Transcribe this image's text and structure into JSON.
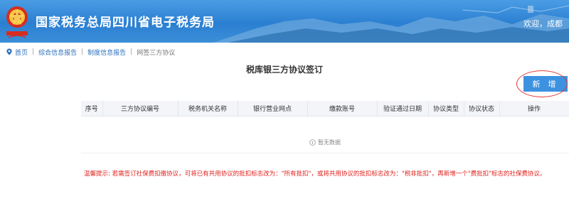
{
  "header": {
    "site_title": "国家税务总局四川省电子税务局",
    "welcome_text": "欢迎，成都"
  },
  "breadcrumb": {
    "items": [
      "首页",
      "综合信息报告",
      "制度信息报告"
    ],
    "current": "网签三方协议"
  },
  "page": {
    "title": "税库银三方协议签订",
    "add_button_label": "新 增"
  },
  "table": {
    "columns": [
      "序号",
      "三方协议编号",
      "税务机关名称",
      "银行营业网点",
      "缴款账号",
      "验证通过日期",
      "协议类型",
      "协议状态",
      "操作"
    ],
    "rows": [],
    "empty_text": "暂无数据"
  },
  "notice": {
    "text": "温馨提示: 若需签订社保费扣缴协议，可将已有共用协议的批扣标志改为：\"所有批扣\"，或将共用协议的批扣标志改为：\"税非批扣\"，再新增一个\"费批扣\"标志的社保费协议。"
  },
  "colors": {
    "header_blue": "#2b7fd1",
    "button_blue": "#3d92e0",
    "link_blue": "#2c6fbf",
    "notice_red": "#e0201c"
  }
}
